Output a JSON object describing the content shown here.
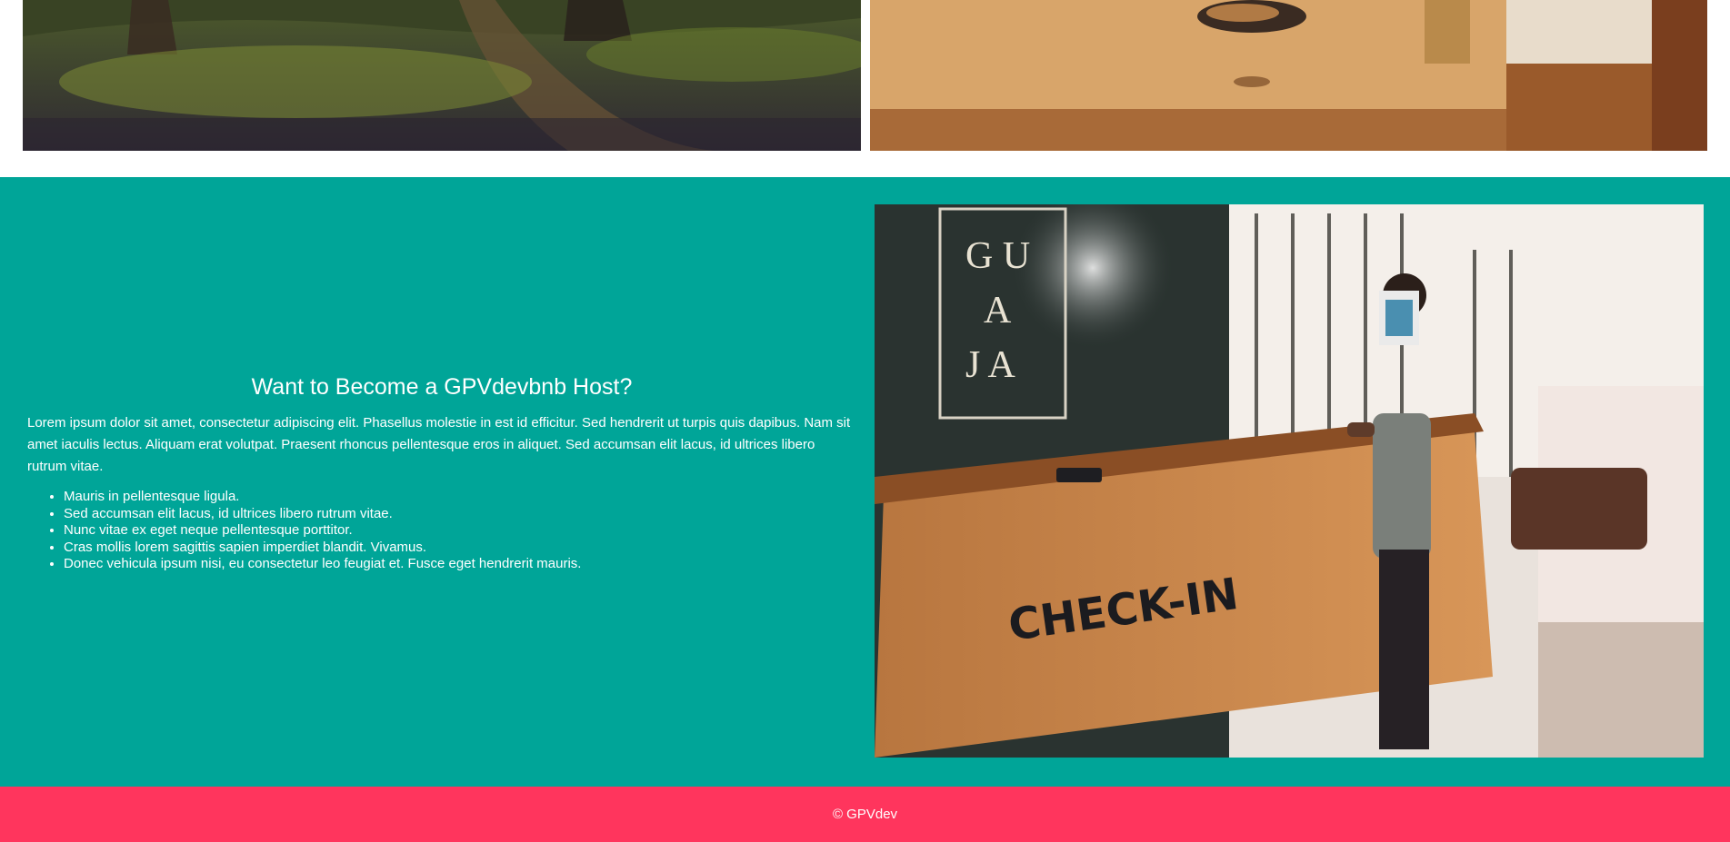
{
  "top_gallery": {
    "forest_photo": {
      "alt": "forest-path-photo"
    },
    "table_photo": {
      "alt": "wooden-table-with-cat-photo"
    }
  },
  "host_section": {
    "title": "Want to Become a GPVdevbnb Host?",
    "paragraph": "Lorem ipsum dolor sit amet, consectetur adipiscing elit. Phasellus molestie in est id efficitur. Sed hendrerit ut turpis quis dapibus. Nam sit amet iaculis lectus. Aliquam erat volutpat. Praesent rhoncus pellentesque eros in aliquet. Sed accumsan elit lacus, id ultrices libero rutrum vitae.",
    "list_items": [
      "Mauris in pellentesque ligula.",
      "Sed accumsan elit lacus, id ultrices libero rutrum vitae.",
      "Nunc vitae ex eget neque pellentesque porttitor.",
      "Cras mollis lorem sagittis sapien imperdiet blandit. Vivamus.",
      "Donec vehicula ipsum nisi, eu consectetur leo feugiat et. Fusce eget hendrerit mauris."
    ],
    "photo": {
      "sign_letters": [
        "G U",
        "A",
        "J A"
      ],
      "desk_text": "CHECK-IN"
    },
    "background_color": "#00a598"
  },
  "footer": {
    "text": "© GPVdev",
    "background_color": "#ff355d"
  }
}
